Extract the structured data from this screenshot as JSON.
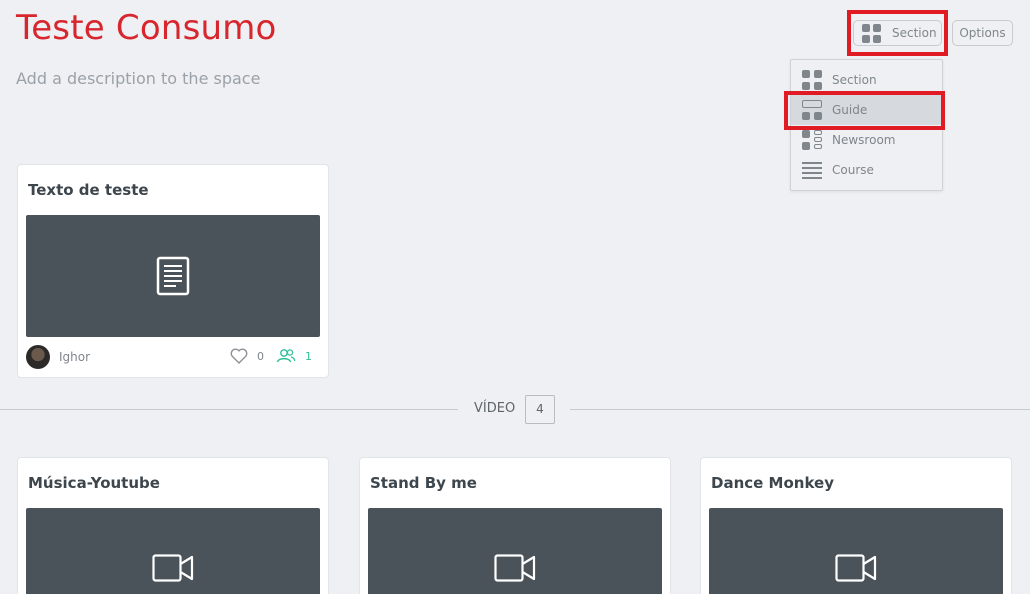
{
  "space": {
    "title": "Teste Consumo",
    "description": "Add a description to the space"
  },
  "toolbar": {
    "layout_label": "Section",
    "options_label": "Options"
  },
  "layout_menu": {
    "items": [
      {
        "label": "Section",
        "icon": "section-grid-icon"
      },
      {
        "label": "Guide",
        "icon": "guide-layout-icon",
        "selected": true
      },
      {
        "label": "Newsroom",
        "icon": "newsroom-layout-icon"
      },
      {
        "label": "Course",
        "icon": "course-list-icon"
      }
    ]
  },
  "top_card": {
    "title": "Texto de teste",
    "thumb_icon": "document-icon",
    "author": "Ighor",
    "likes": "0",
    "participants": "1"
  },
  "video_section": {
    "label": "VÍDEO",
    "count": "4",
    "cards": [
      {
        "title": "Música-Youtube",
        "thumb_icon": "video-camera-icon"
      },
      {
        "title": "Stand By me",
        "thumb_icon": "video-camera-icon"
      },
      {
        "title": "Dance Monkey",
        "thumb_icon": "video-camera-icon"
      }
    ]
  },
  "colors": {
    "title": "#d7262e",
    "highlight": "#e01b24",
    "thumb_bg": "#4a5359",
    "accent_green": "#2fbf9a"
  }
}
